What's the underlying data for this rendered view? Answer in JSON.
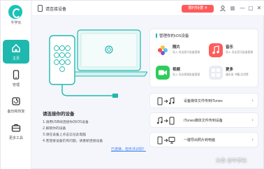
{
  "app": {
    "brand_name": "牛学长"
  },
  "header": {
    "device_title": "请连接设备",
    "promo_label": "限时特惠 ¥",
    "min_label": "—",
    "max_label": "▢",
    "close_label": "✕"
  },
  "sidebar": {
    "items": [
      {
        "label": "主页",
        "active": true
      },
      {
        "label": "管理",
        "active": false
      },
      {
        "label": "备份和恢复",
        "active": false
      },
      {
        "label": "更多工具",
        "active": false
      }
    ]
  },
  "main": {
    "prompt_title": "请连接你的设备",
    "steps": [
      "1.请用USB线连接你的iOS设备",
      "2.解锁你的设备",
      "3.请在设备上点击信任此电脑",
      "4.若连接设备仍有问题，请重新连接设备"
    ],
    "help_link": "已连接，但无法识别？"
  },
  "manage_card": {
    "title": "管理你的iOS设备",
    "features": [
      {
        "name": "照片",
        "desc": "导入 导出照片批量管理",
        "icon": "photos-icon",
        "color": "#ffffff"
      },
      {
        "name": "音乐",
        "desc": "导入 导出音乐批量管理",
        "icon": "music-icon",
        "color": "#ff5b5b"
      },
      {
        "name": "视频",
        "desc": "导入 导出视频批量管理",
        "icon": "video-icon",
        "color": "#2ecc5a"
      },
      {
        "name": "更多",
        "desc": "通讯录 书籍 应用等",
        "icon": "more-icon",
        "color": "#e9ecf2"
      }
    ]
  },
  "transfer_rows": [
    {
      "label": "设备媒体文件传到iTunes"
    },
    {
      "label": "iTunes媒体文件传到设备"
    },
    {
      "label": "一键导出照片到电脑"
    }
  ],
  "watermark": "头条 @牛学长",
  "colors": {
    "accent": "#1fb8ae",
    "promo": "#ff5a5a"
  }
}
